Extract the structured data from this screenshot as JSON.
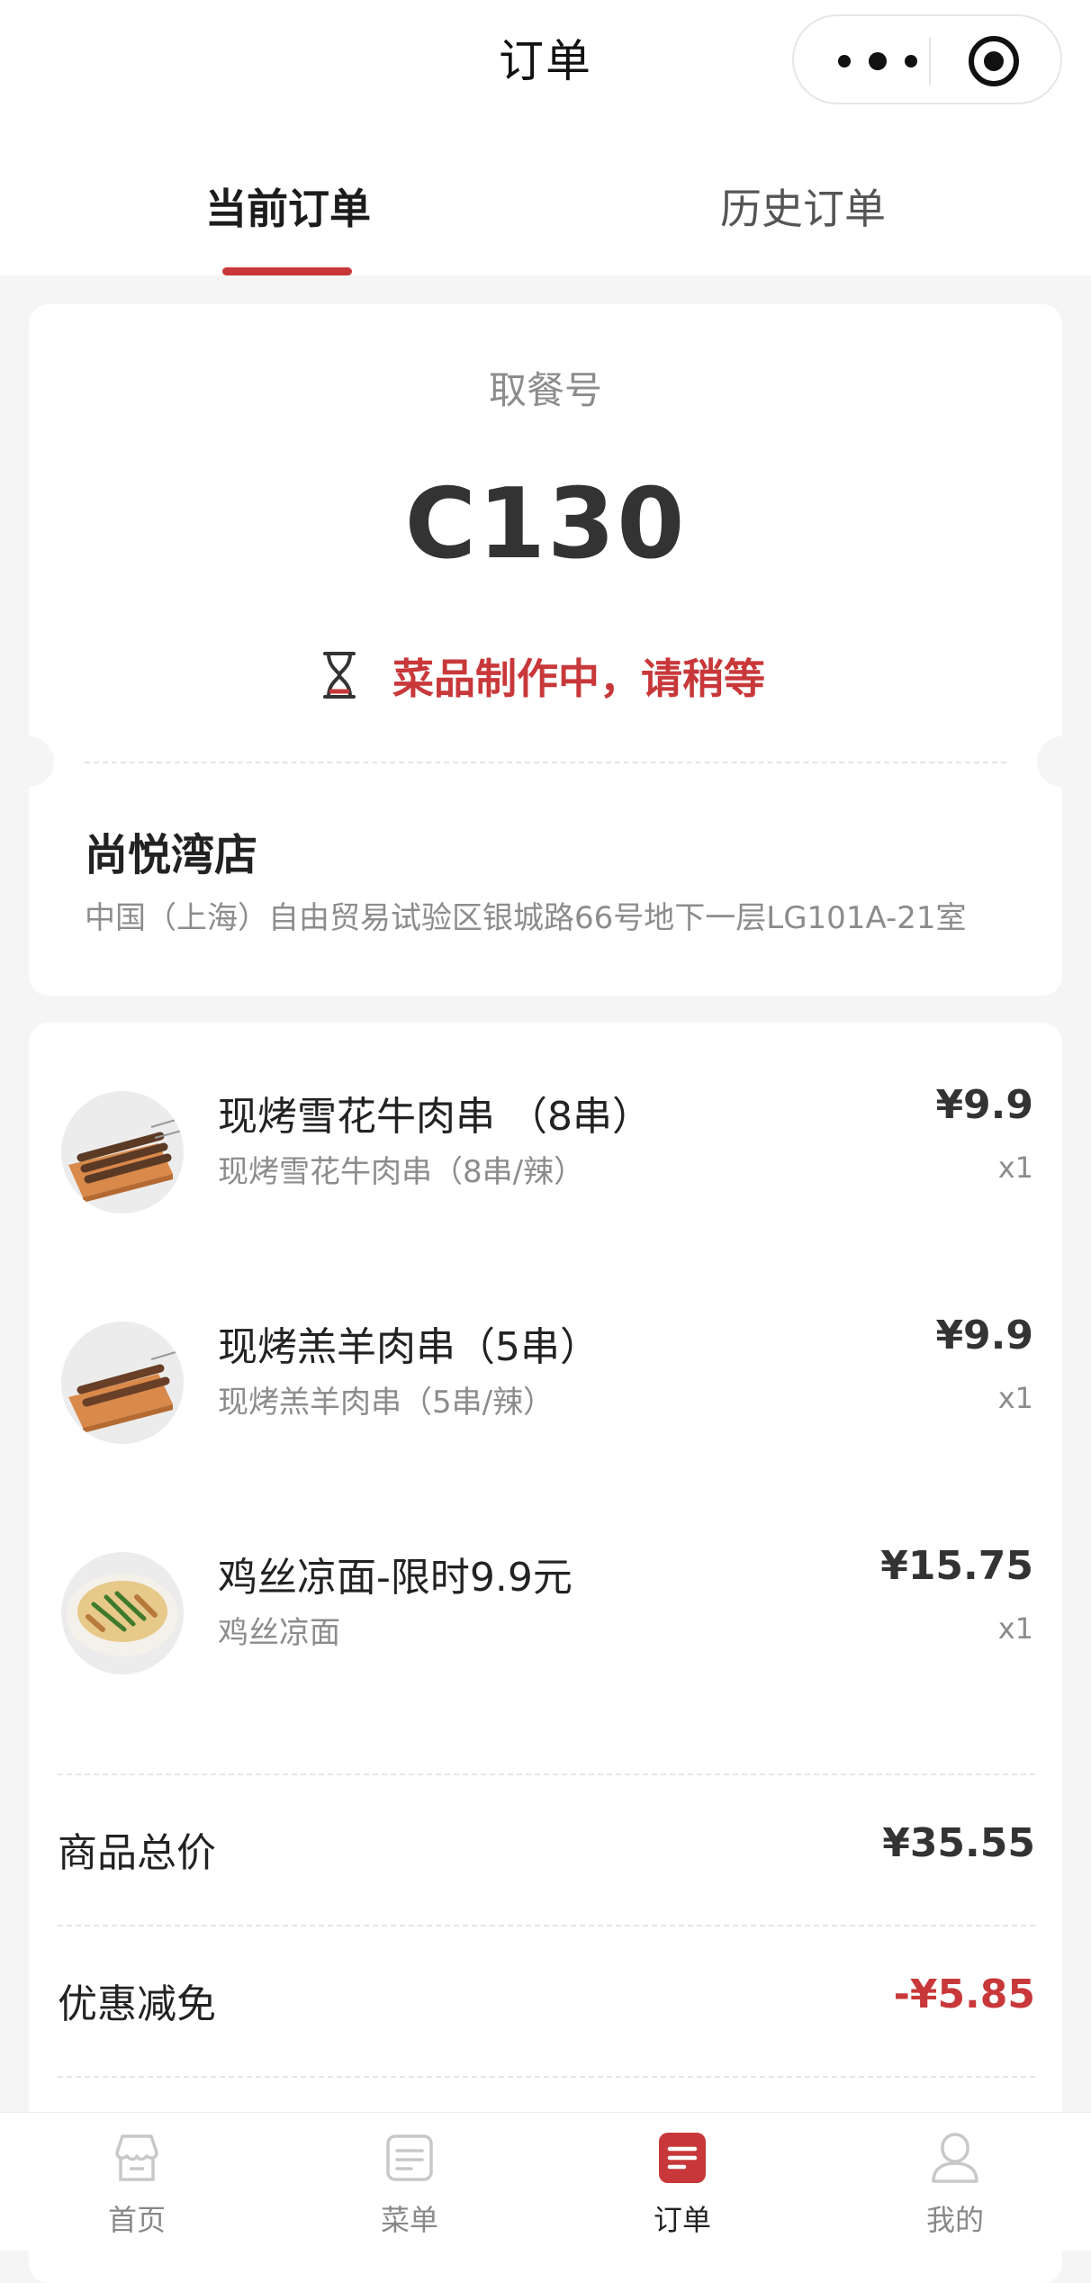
{
  "nav": {
    "title": "订单"
  },
  "tabs": {
    "current": "当前订单",
    "history": "历史订单"
  },
  "pickup": {
    "label": "取餐号",
    "number": "C130",
    "status": "菜品制作中，请稍等"
  },
  "store": {
    "name": "尚悦湾店",
    "address": "中国（上海）自由贸易试验区银城路66号地下一层LG101A-21室"
  },
  "items": [
    {
      "name": "现烤雪花牛肉串 （8串）",
      "spec": "现烤雪花牛肉串（8串/辣）",
      "price": "¥9.9",
      "qty": "x1",
      "image": "beef-skewers-photo"
    },
    {
      "name": "现烤羔羊肉串（5串）",
      "spec": "现烤羔羊肉串（5串/辣）",
      "price": "¥9.9",
      "qty": "x1",
      "image": "lamb-skewers-photo"
    },
    {
      "name": "鸡丝凉面-限时9.9元",
      "spec": "鸡丝凉面",
      "price": "¥15.75",
      "qty": "x1",
      "image": "cold-noodles-photo"
    }
  ],
  "summary": {
    "total_label": "商品总价",
    "total_value": "¥35.55",
    "discount_label": "优惠减免",
    "discount_value": "-¥5.85"
  },
  "tabbar": [
    {
      "label": "首页",
      "icon": "home-icon"
    },
    {
      "label": "菜单",
      "icon": "menu-icon"
    },
    {
      "label": "订单",
      "icon": "order-icon",
      "active": true
    },
    {
      "label": "我的",
      "icon": "profile-icon"
    }
  ],
  "colors": {
    "accent": "#c8383a",
    "background": "#f5f5f5"
  }
}
